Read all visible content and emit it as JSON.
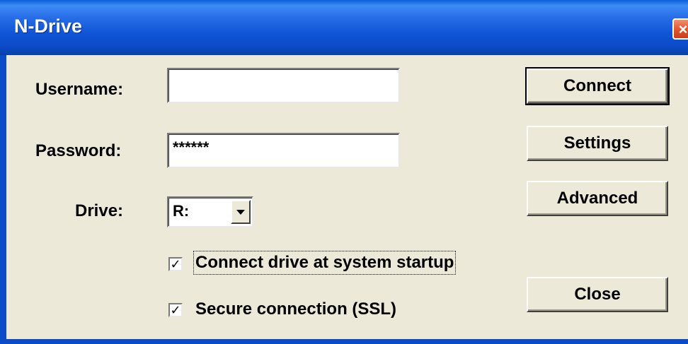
{
  "window": {
    "title": "N-Drive",
    "close_glyph": "×"
  },
  "form": {
    "username_label": "Username:",
    "username_value": "",
    "password_label": "Password:",
    "password_value": "******",
    "drive_label": "Drive:",
    "drive_value": "R:"
  },
  "options": {
    "startup_label": "Connect drive at system startup",
    "startup_checked": true,
    "startup_glyph": "✓",
    "ssl_label": "Secure connection (SSL)",
    "ssl_checked": true,
    "ssl_glyph": "✓"
  },
  "buttons": {
    "connect": "Connect",
    "settings": "Settings",
    "advanced": "Advanced",
    "close": "Close"
  },
  "colors": {
    "titlebar": "#0b4bc8",
    "dialog_bg": "#ece9d8",
    "close_red": "#e0542a"
  }
}
